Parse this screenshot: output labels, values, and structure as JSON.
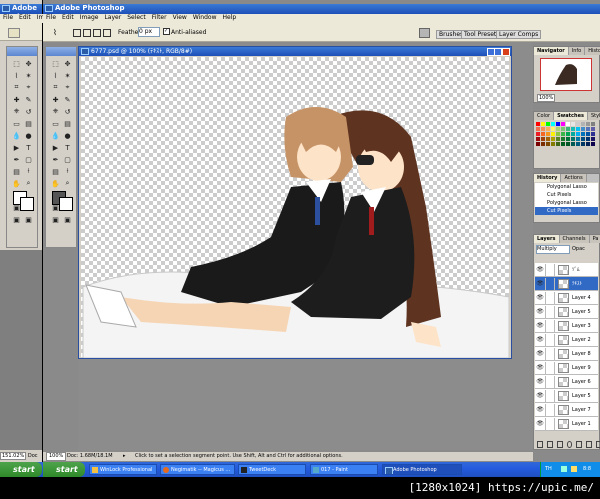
{
  "windows": {
    "back1_title": "Adobe Ph",
    "back2_title": "Adobe Photoshop"
  },
  "menu": {
    "back1": [
      "File",
      "Edit",
      "Im"
    ],
    "main": [
      "File",
      "Edit",
      "Image",
      "Layer",
      "Select",
      "Filter",
      "View",
      "Window",
      "Help"
    ]
  },
  "options": {
    "feather_label": "Feather:",
    "feather_value": "0 px",
    "antialiased_label": "Anti-aliased",
    "palette_tabs": [
      "Brushes",
      "Tool Presets",
      "Layer Comps"
    ]
  },
  "document": {
    "title": "6777.psd @ 100% (ﾃｷｽﾄ, RGB/8#)",
    "zoom": "100%",
    "doc_size": "Doc: 1.68M/18.1M",
    "hint": "Click to set a selection segment point. Use Shift, Alt and Ctrl for additional options."
  },
  "back_status": {
    "zoom": "151.02%",
    "doc": "Doc"
  },
  "navigator": {
    "tabs": [
      "Navigator",
      "Info",
      "Histo"
    ],
    "zoom": "100%"
  },
  "color_panel": {
    "tabs": [
      "Color",
      "Swatches",
      "Styles"
    ],
    "swatches": [
      "#ff0000",
      "#ffff00",
      "#00ff00",
      "#00ffff",
      "#0000ff",
      "#ff00ff",
      "#ffffff",
      "#e6e6e6",
      "#cccccc",
      "#b3b3b3",
      "#999999",
      "#808080",
      "#f26c4f",
      "#f68e55",
      "#fbaf5c",
      "#fff467",
      "#acd372",
      "#7cc576",
      "#3bb878",
      "#1abbb4",
      "#00bff3",
      "#438cca",
      "#5574b9",
      "#605ca8",
      "#ed1c24",
      "#f26522",
      "#f7941d",
      "#fff200",
      "#8dc63f",
      "#39b54a",
      "#00a651",
      "#00a99d",
      "#00aeef",
      "#0072bc",
      "#0054a6",
      "#2e3192",
      "#9e0b0f",
      "#a0410d",
      "#a3620a",
      "#aba000",
      "#598527",
      "#1a7b30",
      "#007236",
      "#00746b",
      "#0076a3",
      "#004b80",
      "#003471",
      "#1b1464",
      "#790000",
      "#7b2e00",
      "#7d4900",
      "#827b00",
      "#406618",
      "#005e20",
      "#005826",
      "#005952",
      "#005b7f",
      "#003663",
      "#002157",
      "#0d004c"
    ]
  },
  "history": {
    "tabs": [
      "History",
      "Actions"
    ],
    "items": [
      "Polygonal Lasso",
      "Cut Pixels",
      "Polygonal Lasso",
      "Cut Pixels"
    ],
    "selected_index": 3
  },
  "layers": {
    "tabs": [
      "Layers",
      "Channels",
      "Pa"
    ],
    "blend_mode": "Multiply",
    "opacity_label": "Opac",
    "items": [
      {
        "name": "ｿﾞﾑ",
        "selected": false
      },
      {
        "name": "ﾃｷｽﾄ",
        "selected": true
      },
      {
        "name": "Layer 4",
        "selected": false
      },
      {
        "name": "Layer 5",
        "selected": false
      },
      {
        "name": "Layer 3",
        "selected": false
      },
      {
        "name": "Layer 2",
        "selected": false
      },
      {
        "name": "Layer 8",
        "selected": false
      },
      {
        "name": "Layer 9",
        "selected": false
      },
      {
        "name": "Layer 6",
        "selected": false
      },
      {
        "name": "Layer 5",
        "selected": false
      },
      {
        "name": "Layer 7",
        "selected": false
      },
      {
        "name": "Layer 1",
        "selected": false
      }
    ]
  },
  "taskbar": {
    "start1": "start",
    "start2": "start",
    "tasks": [
      "WinLock Professional",
      "Negimatik -- Magicus ...",
      "TweetDeck",
      "017 - Paint",
      "Adobe Photoshop"
    ],
    "tray_lang": "TH",
    "clock": "8:8"
  },
  "watermark": "[1280x1024] https://upic.me/",
  "colors": {
    "title_blue": "#245edb",
    "ui_gray": "#d4d0c8",
    "selection": "#316ac5",
    "taskbar_blue": "#245ce0",
    "start_green": "#3c9d36"
  }
}
